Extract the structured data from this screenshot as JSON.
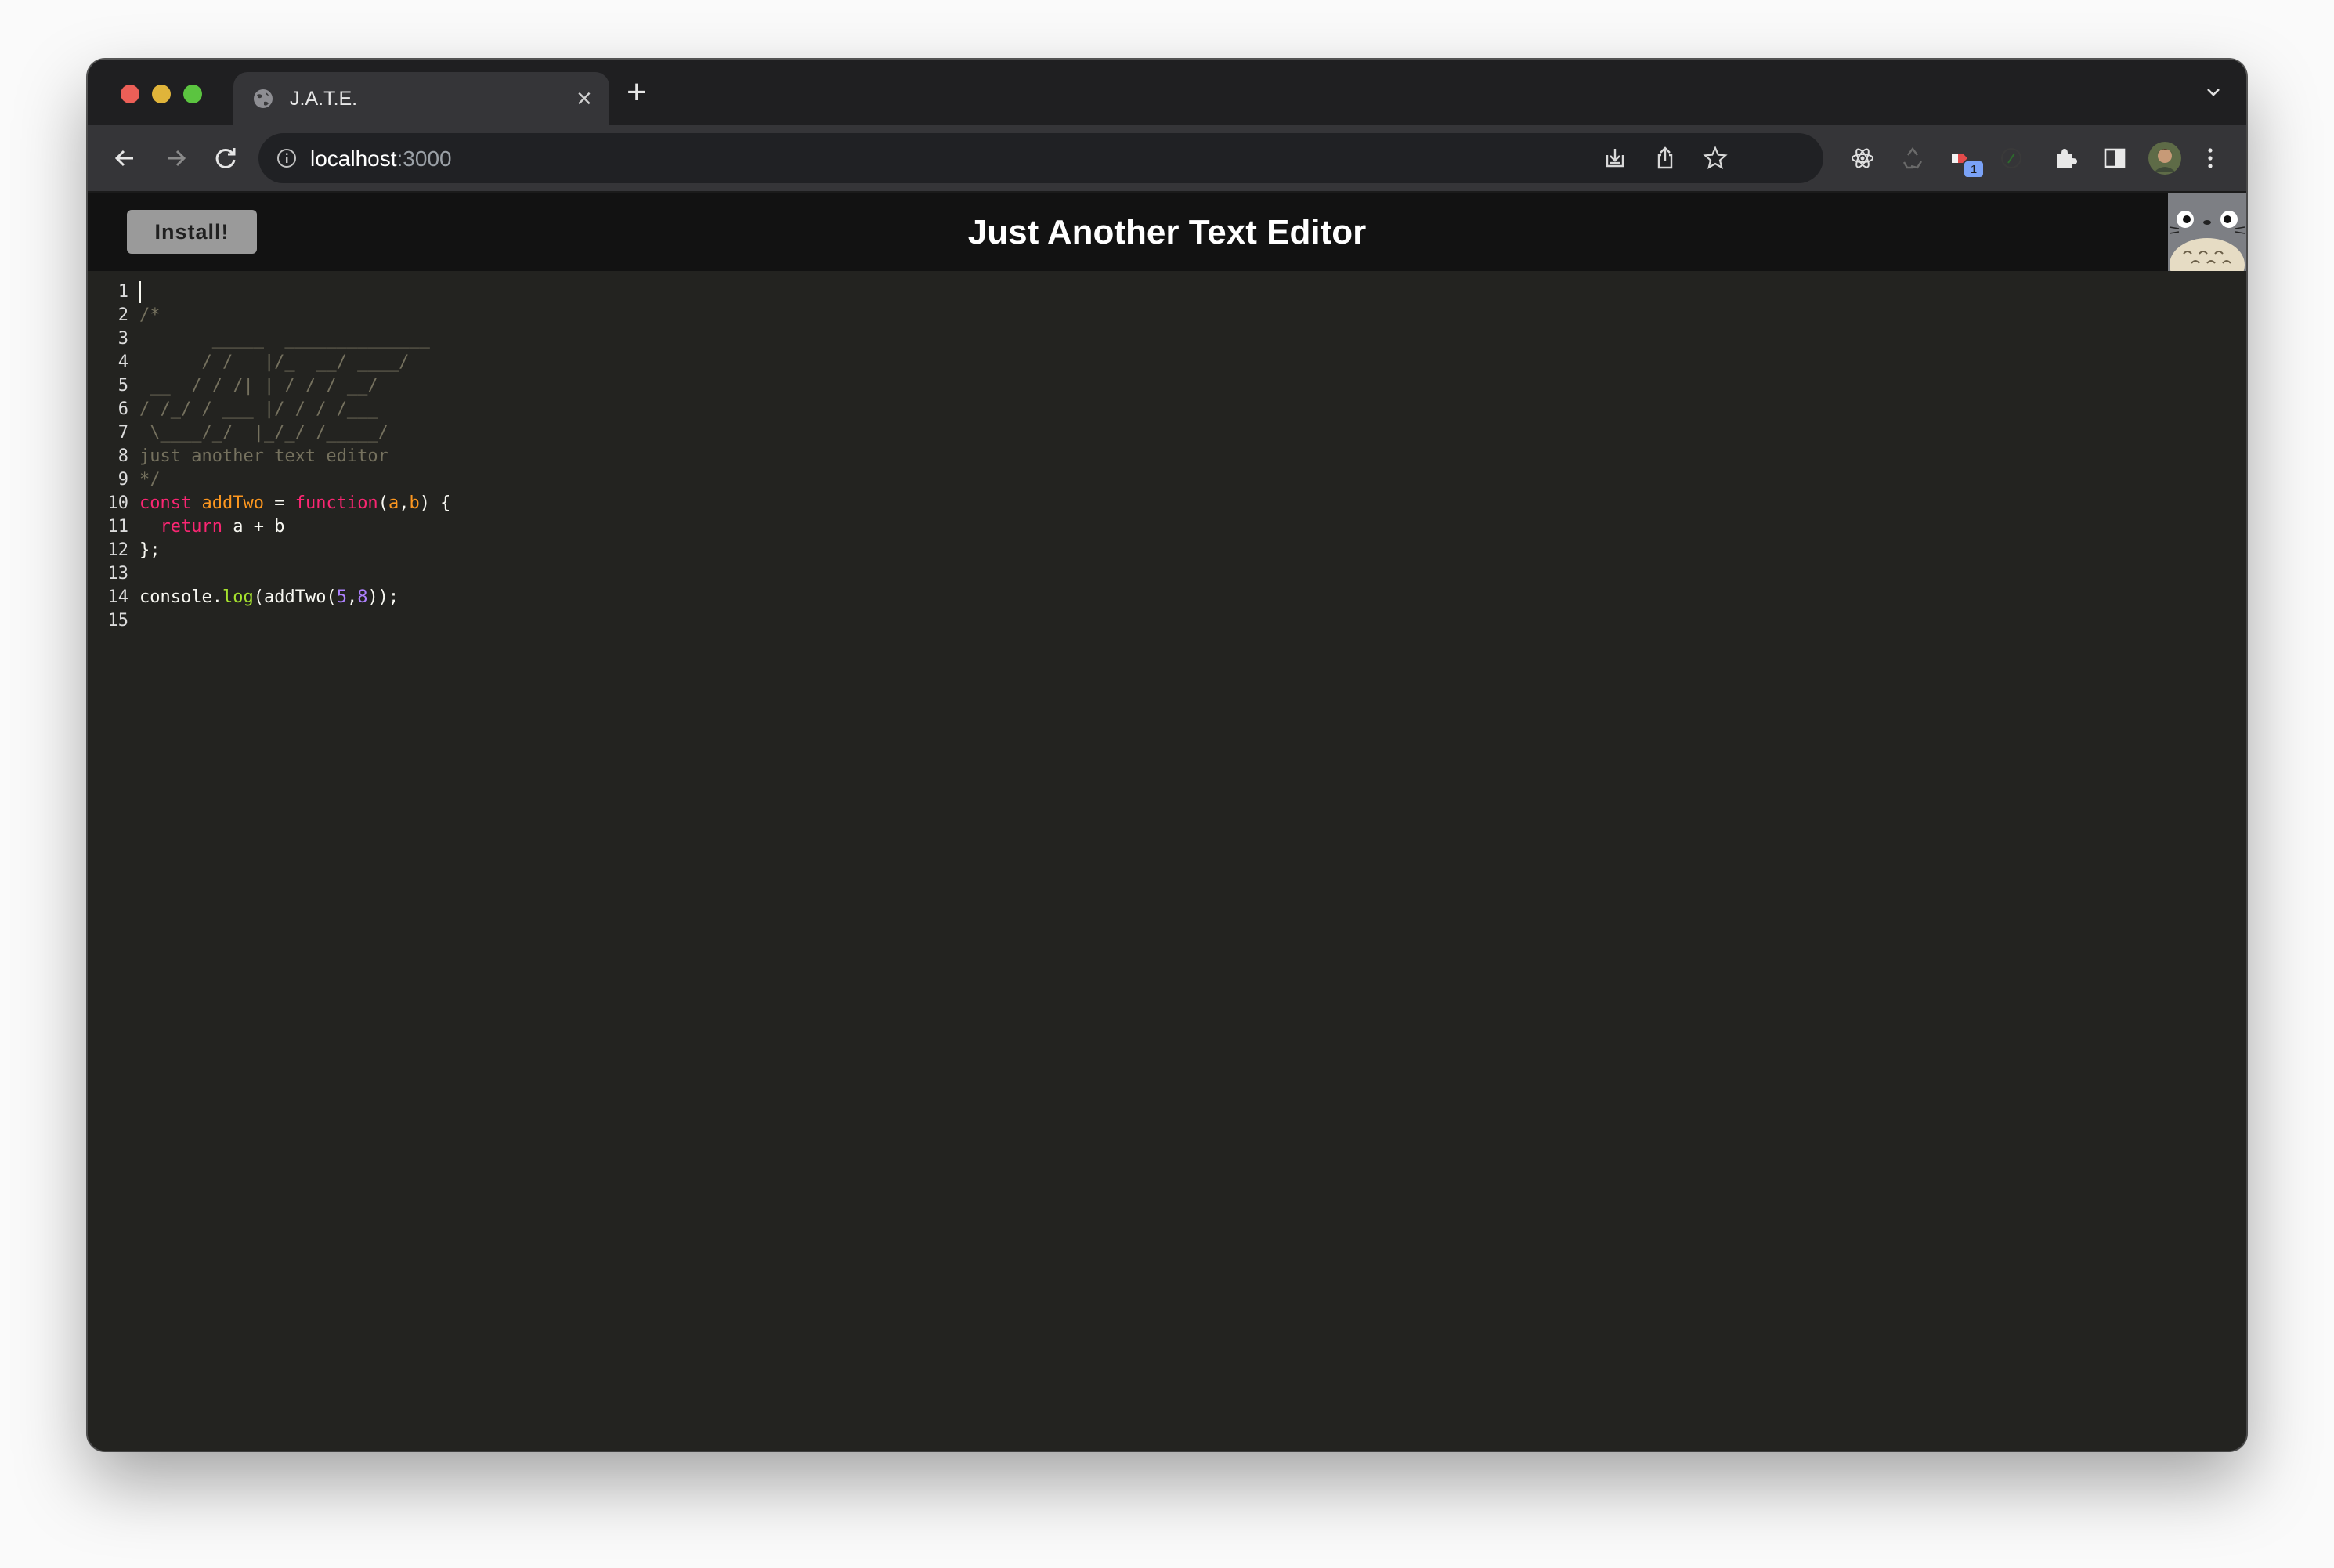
{
  "browser": {
    "tab_title": "J.A.T.E.",
    "url_host": "localhost",
    "url_port": ":3000",
    "extension_badge": "1"
  },
  "app": {
    "install_label": "Install!",
    "title": "Just Another Text Editor"
  },
  "editor": {
    "line_numbers": [
      "1",
      "2",
      "3",
      "4",
      "5",
      "6",
      "7",
      "8",
      "9",
      "10",
      "11",
      "12",
      "13",
      "14",
      "15"
    ],
    "comment_lines": [
      "/*",
      "       _____  ______________",
      "      / /   |/_  __/ ____/",
      " __  / / /| | / / / __/",
      "/ /_/ / ___ |/ / / /___",
      " \\____/_/  |_/_/ /_____/",
      "just another text editor",
      "*/"
    ],
    "code": {
      "kw_const": "const",
      "fn_name": "addTwo",
      "op_eq": " = ",
      "kw_function": "function",
      "paren_open": "(",
      "param_a": "a",
      "comma": ",",
      "param_b": "b",
      "paren_close_brace": ") {",
      "indent": "  ",
      "kw_return": "return",
      "return_expr": " a + b",
      "close_brace": "};",
      "console": "console.",
      "log": "log",
      "call_open": "(addTwo(",
      "arg1": "5",
      "arg_comma": ",",
      "arg2": "8",
      "call_close": "));"
    }
  },
  "colors": {
    "comment": "#75715e",
    "keyword": "#f92672",
    "definition": "#fd971f",
    "variable": "#a6e22e",
    "number": "#ae81ff",
    "editor_bg": "#232320"
  }
}
